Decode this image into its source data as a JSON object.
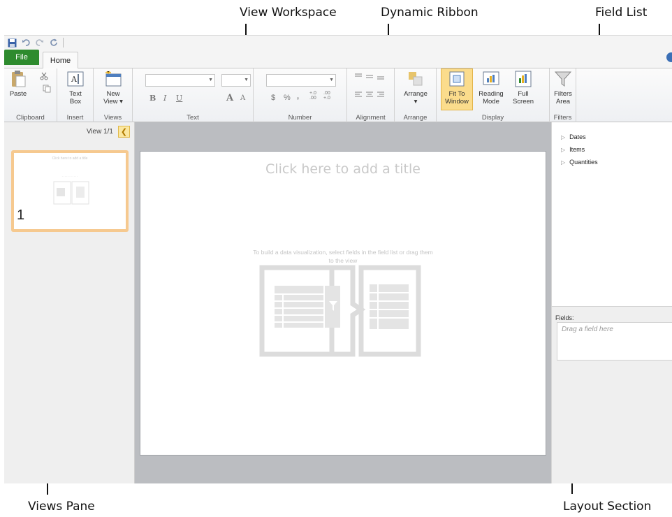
{
  "callouts": {
    "view_workspace": "View Workspace",
    "dynamic_ribbon": "Dynamic Ribbon",
    "field_list": "Field List",
    "views_pane": "Views Pane",
    "layout_section": "Layout Section"
  },
  "tabs": {
    "file": "File",
    "home": "Home"
  },
  "ribbon": {
    "clipboard": {
      "paste": "Paste",
      "label": "Clipboard"
    },
    "insert": {
      "text_box": "Text\nBox",
      "label": "Insert"
    },
    "views": {
      "new_view": "New\nView ▾",
      "label": "Views"
    },
    "text": {
      "bold": "B",
      "italic": "I",
      "underline": "U",
      "grow": "A",
      "shrink": "A",
      "label": "Text"
    },
    "number": {
      "currency": "$",
      "percent": "%",
      "comma": ",",
      "inc": "+.0\n.00",
      "dec": ".00\n+.0",
      "label": "Number"
    },
    "alignment": {
      "label": "Alignment"
    },
    "arrange": {
      "arrange": "Arrange\n▾",
      "label": "Arrange"
    },
    "display": {
      "fit": "Fit To\nWindow",
      "reading": "Reading\nMode",
      "full": "Full\nScreen",
      "label": "Display"
    },
    "filters": {
      "filters_area": "Filters\nArea",
      "label": "Filters"
    }
  },
  "views_pane": {
    "counter": "View 1/1",
    "thumb_title": "Click here to add a title",
    "thumb_number": "1"
  },
  "workspace": {
    "title_placeholder": "Click here to add a title",
    "hint": "To build a data visualization, select fields in the field list or drag them to the view"
  },
  "field_list": {
    "items": [
      "Dates",
      "Items",
      "Quantities"
    ]
  },
  "layout_section": {
    "fields_label": "Fields:",
    "drop_placeholder": "Drag a field here"
  },
  "colors": {
    "file_tab": "#2e8b2e",
    "selected_view": "#f6c98f",
    "workspace_bg": "#bbbdc1",
    "active_button": "#fbdc8c"
  }
}
